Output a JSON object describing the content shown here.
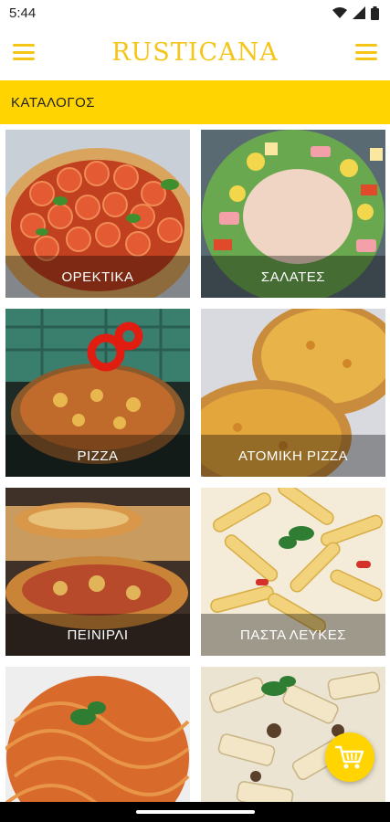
{
  "status_bar": {
    "time": "5:44",
    "icons": [
      "wifi-icon",
      "cellular-icon",
      "battery-icon"
    ]
  },
  "header": {
    "brand": "RUSTICANA",
    "left_icon": "menu-icon",
    "right_icon": "menu-icon",
    "accent_color": "#f5c518"
  },
  "section": {
    "title": "ΚΑΤΑΛΟΓΟΣ",
    "bar_color": "#ffd400"
  },
  "categories": [
    {
      "label": "ΟΡΕΚΤΙΚΑ"
    },
    {
      "label": "ΣΑΛΑΤΕΣ"
    },
    {
      "label": "PIZZA"
    },
    {
      "label": "ΑΤΟΜΙΚΗ PIZZA"
    },
    {
      "label": "ΠΕΙΝΙΡΛΙ"
    },
    {
      "label": "ΠΑΣΤΑ ΛΕΥΚΕΣ"
    },
    {
      "label": ""
    },
    {
      "label": ""
    }
  ],
  "cart_button": {
    "icon": "shopping-cart-icon",
    "color": "#ffd400"
  }
}
